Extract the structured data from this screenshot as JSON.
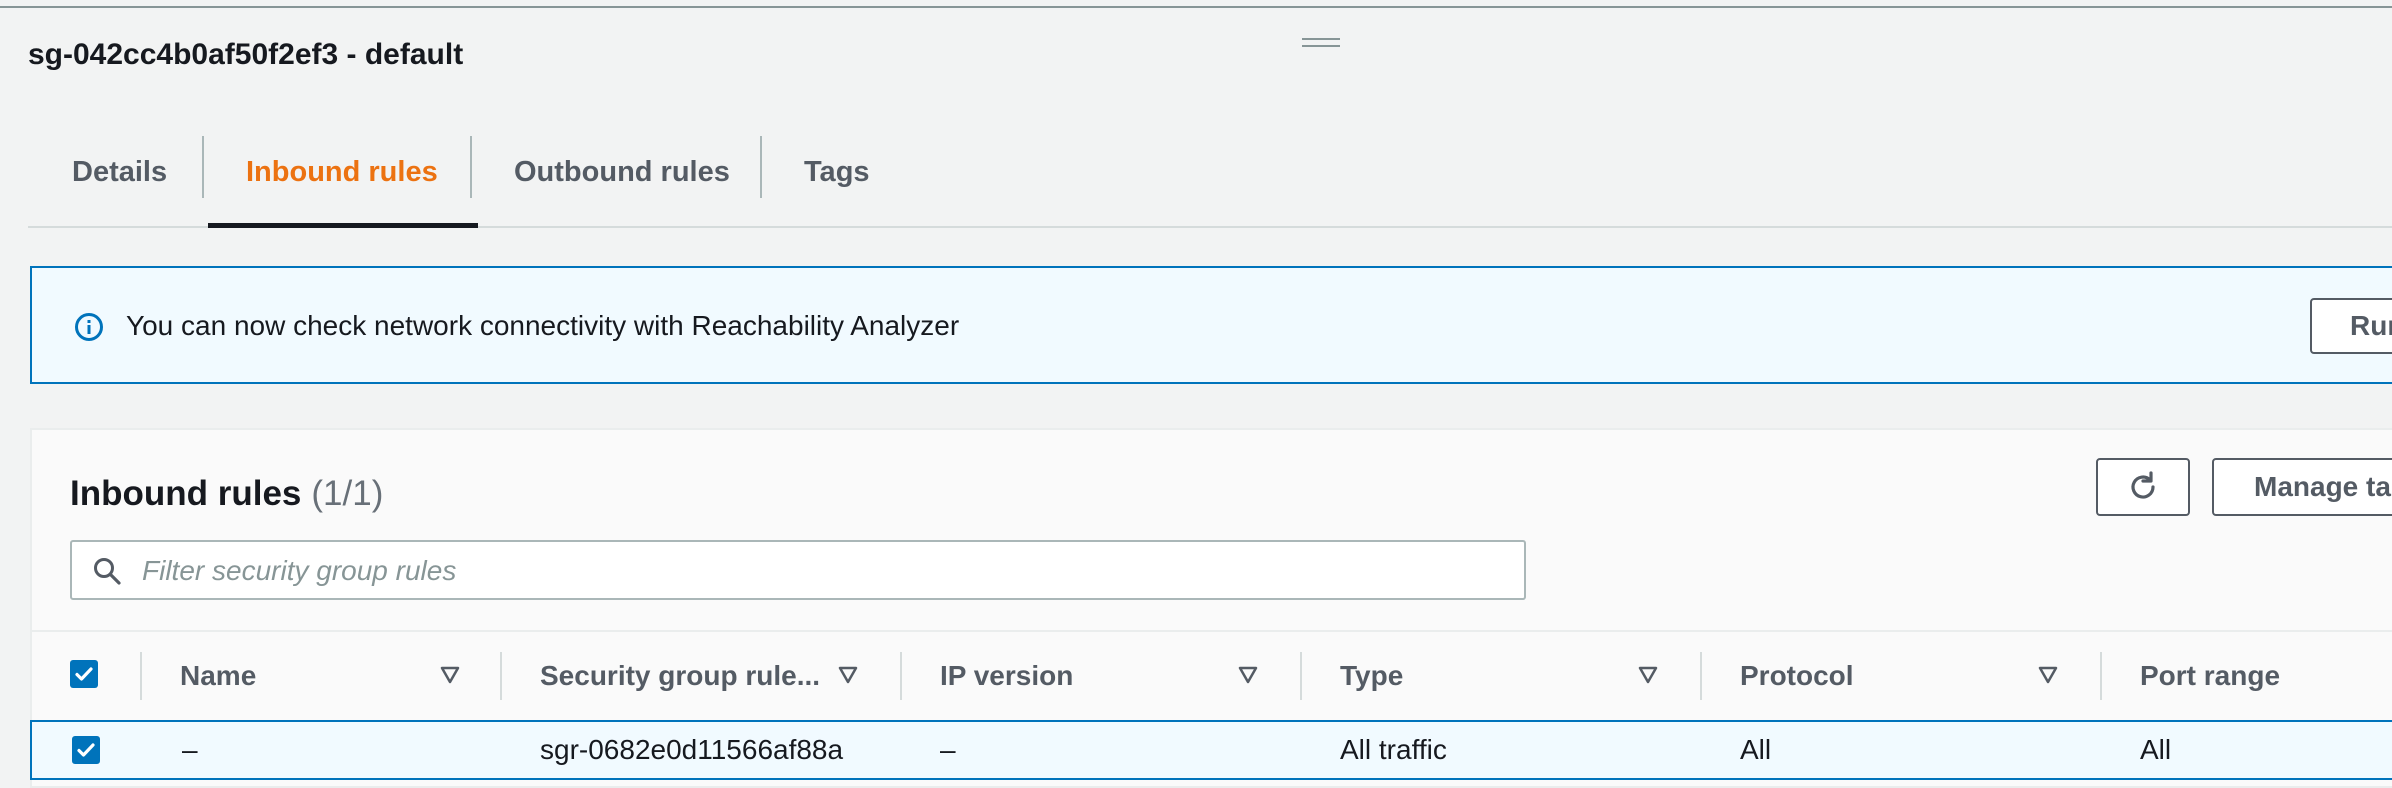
{
  "security_group": {
    "title": "sg-042cc4b0af50f2ef3 - default"
  },
  "tabs": [
    {
      "label": "Details"
    },
    {
      "label": "Inbound rules"
    },
    {
      "label": "Outbound rules"
    },
    {
      "label": "Tags"
    }
  ],
  "active_tab": "Inbound rules",
  "alert": {
    "icon": "info-icon",
    "text": "You can now check network connectivity with Reachability Analyzer",
    "button_label": "Run"
  },
  "panel": {
    "title": "Inbound rules",
    "count": "(1/1)",
    "refresh_icon": "refresh-icon",
    "manage_tags_label": "Manage tags",
    "search": {
      "placeholder": "Filter security group rules",
      "value": ""
    }
  },
  "table": {
    "select_all_checked": true,
    "columns": [
      {
        "label": "Name"
      },
      {
        "label": "Security group rule..."
      },
      {
        "label": "IP version"
      },
      {
        "label": "Type"
      },
      {
        "label": "Protocol"
      },
      {
        "label": "Port range"
      }
    ],
    "rows": [
      {
        "checked": true,
        "name": "–",
        "security_group_rule_id": "sgr-0682e0d11566af88a",
        "ip_version": "–",
        "type": "All traffic",
        "protocol": "All",
        "port_range": "All"
      }
    ]
  },
  "colors": {
    "accent": "#ec7211",
    "link_blue": "#0073bb",
    "text": "#16191f",
    "muted": "#545b64"
  }
}
